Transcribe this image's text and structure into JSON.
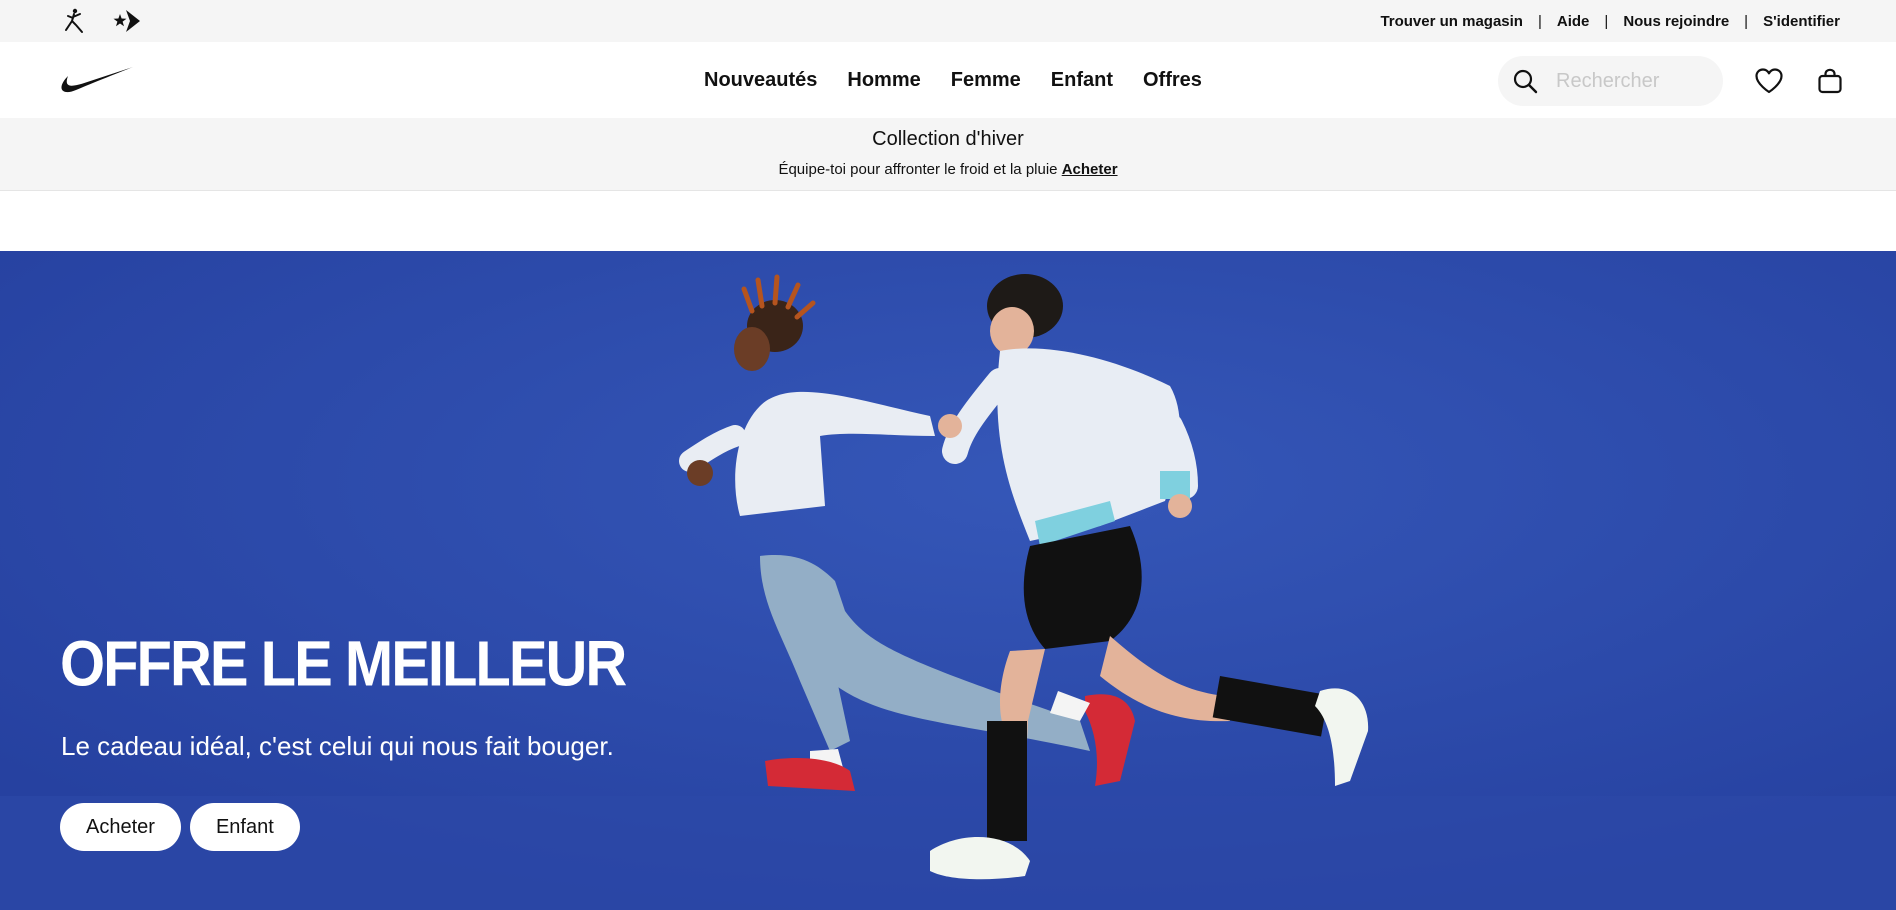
{
  "utility": {
    "brands": [
      "jordan-icon",
      "converse-icon"
    ],
    "links": [
      "Trouver un magasin",
      "Aide",
      "Nous rejoindre",
      "S'identifier"
    ],
    "separator": "|"
  },
  "nav": {
    "logo": "nike-swoosh-icon",
    "menu": [
      "Nouveautés",
      "Homme",
      "Femme",
      "Enfant",
      "Offres"
    ],
    "search_placeholder": "Rechercher",
    "icons": [
      "search-icon",
      "heart-icon",
      "bag-icon"
    ]
  },
  "promo": {
    "title": "Collection d'hiver",
    "text": "Équipe-toi pour affronter le froid et la pluie",
    "link": "Acheter"
  },
  "hero": {
    "headline": "OFFRE LE MEILLEUR",
    "tagline": "Le cadeau idéal, c'est celui qui nous fait bouger.",
    "buttons": [
      "Acheter",
      "Enfant"
    ],
    "background_color": "#2a47a6"
  }
}
